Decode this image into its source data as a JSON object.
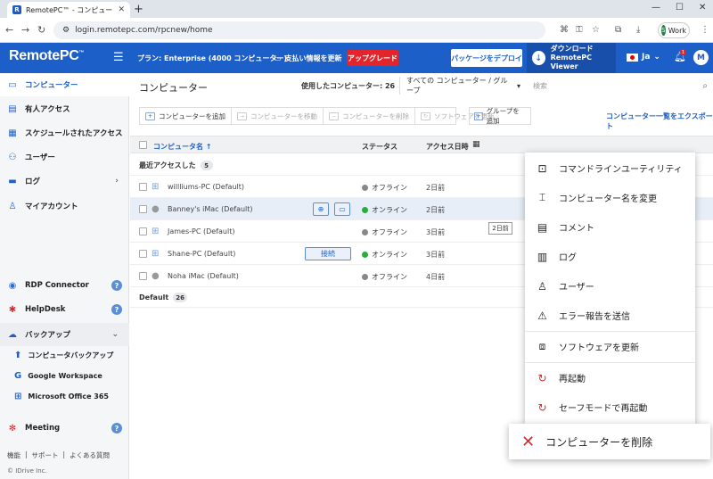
{
  "browser": {
    "tab_title": "RemotePC™ - コンピューター",
    "url": "login.remotepc.com/rpcnew/home",
    "profile_label": "Work",
    "profile_initial": "S"
  },
  "header": {
    "logo": "RemotePC",
    "plan": "プラン: Enterprise (4000 コンピューター)",
    "payment_info": "支払い情報を更新",
    "upgrade": "アップグレード",
    "deploy": "パッケージをデプロイ",
    "download_line1": "ダウンロード",
    "download_line2": "RemotePC Viewer",
    "language": "Ja",
    "notification_count": "1",
    "user_initial": "M"
  },
  "sidebar": {
    "items": [
      {
        "label": "コンピューター",
        "icon": "monitor-icon"
      },
      {
        "label": "有人アクセス",
        "icon": "attended-icon"
      },
      {
        "label": "スケジュールされたアクセス",
        "icon": "calendar-icon"
      },
      {
        "label": "ユーザー",
        "icon": "users-icon"
      },
      {
        "label": "ログ",
        "icon": "log-icon"
      },
      {
        "label": "マイアカウント",
        "icon": "account-icon"
      }
    ],
    "rdp": "RDP Connector",
    "helpdesk": "HelpDesk",
    "backup": "バックアップ",
    "backup_sub": [
      "コンピュータバックアップ",
      "Google Workspace",
      "Microsoft Office 365"
    ],
    "meeting": "Meeting",
    "footer_links": [
      "機能",
      "サポート",
      "よくある質問"
    ],
    "copyright": "© IDrive Inc."
  },
  "main": {
    "title": "コンピューター",
    "used_label": "使用したコンピューター: 26",
    "group_filter": "すべての コンピューター / グループ",
    "search_placeholder": "検索",
    "toolbar": [
      "コンピューターを追加",
      "コンピューターを移動",
      "コンピューターを削除",
      "ソフトウェアを更新"
    ],
    "group_button": "グループを追加",
    "export": "コンピューター一覧をエクスポート",
    "columns": {
      "name": "コンピュータ名 ↑",
      "status": "ステータス",
      "access": "アクセス日時"
    },
    "recent_group": "最近アクセスした",
    "recent_count": "5",
    "rows": [
      {
        "name": "willliums-PC (Default)",
        "os": "windows",
        "status": "オフライン",
        "online": false,
        "time": "2日前"
      },
      {
        "name": "Banney's iMac (Default)",
        "os": "apple",
        "status": "オンライン",
        "online": true,
        "time": "2日前"
      },
      {
        "name": "James-PC (Default)",
        "os": "windows",
        "status": "オフライン",
        "online": false,
        "time": "3日前"
      },
      {
        "name": "Shane-PC (Default)",
        "os": "windows",
        "status": "オンライン",
        "online": true,
        "time": "3日前"
      },
      {
        "name": "Noha iMac (Default)",
        "os": "apple",
        "status": "オフライン",
        "online": false,
        "time": "4日前"
      }
    ],
    "connect_label": "接続",
    "tooltip": "2日前",
    "default_group": "Default",
    "default_count": "26"
  },
  "context_menu": {
    "items": [
      "コマンドラインユーティリティ",
      "コンピューター名を変更",
      "コメント",
      "ログ",
      "ユーザー",
      "エラー報告を送信",
      "ソフトウェアを更新",
      "再起動",
      "セーフモードで再起動"
    ],
    "delete": "コンピューターを削除"
  },
  "colors": {
    "brand": "#1d5fc8",
    "upgrade": "#e3242b",
    "online": "#2eaa3e",
    "offline": "#888888"
  }
}
